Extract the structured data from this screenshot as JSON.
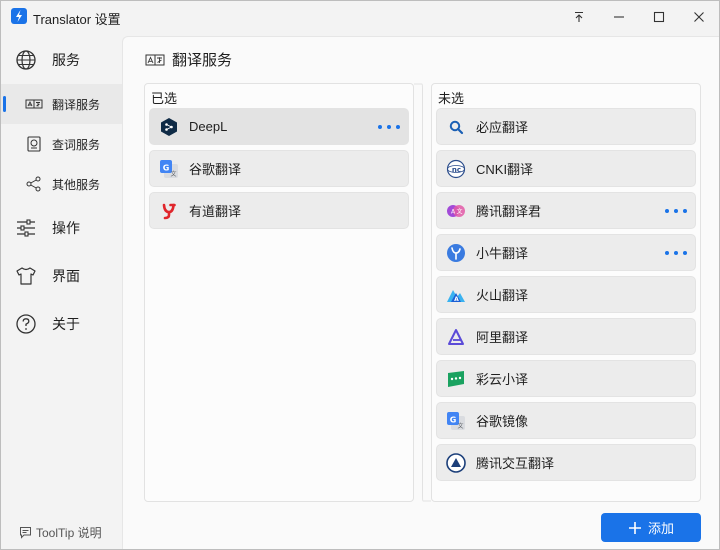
{
  "window": {
    "title": "Translator 设置"
  },
  "sidebar": {
    "items": [
      {
        "label": "服务",
        "icon": "globe-icon"
      },
      {
        "label": "翻译服务",
        "icon": "translate-icon"
      },
      {
        "label": "查词服务",
        "icon": "dictionary-icon"
      },
      {
        "label": "其他服务",
        "icon": "share-icon"
      },
      {
        "label": "操作",
        "icon": "sliders-icon"
      },
      {
        "label": "界面",
        "icon": "shirt-icon"
      },
      {
        "label": "关于",
        "icon": "help-icon"
      }
    ],
    "tooltip_label": "ToolTip 说明"
  },
  "main": {
    "title": "翻译服务",
    "selected": {
      "title": "已选",
      "services": [
        {
          "name": "DeepL",
          "icon": "deepl-icon"
        },
        {
          "name": "谷歌翻译",
          "icon": "google-translate-icon"
        },
        {
          "name": "有道翻译",
          "icon": "youdao-icon"
        }
      ]
    },
    "unselected": {
      "title": "未选",
      "services": [
        {
          "name": "必应翻译",
          "icon": "bing-search-icon"
        },
        {
          "name": "CNKI翻译",
          "icon": "cnki-icon"
        },
        {
          "name": "腾讯翻译君",
          "icon": "tencent-translate-icon"
        },
        {
          "name": "小牛翻译",
          "icon": "niutrans-icon"
        },
        {
          "name": "火山翻译",
          "icon": "volcano-icon"
        },
        {
          "name": "阿里翻译",
          "icon": "ali-icon"
        },
        {
          "name": "彩云小译",
          "icon": "caiyun-icon"
        },
        {
          "name": "谷歌镜像",
          "icon": "google-mirror-icon"
        },
        {
          "name": "腾讯交互翻译",
          "icon": "tencent-interactive-icon"
        }
      ]
    },
    "add_label": "添加"
  },
  "colors": {
    "accent": "#1a73e8",
    "youdao": "#e0262c",
    "caiyun": "#1aa260"
  }
}
